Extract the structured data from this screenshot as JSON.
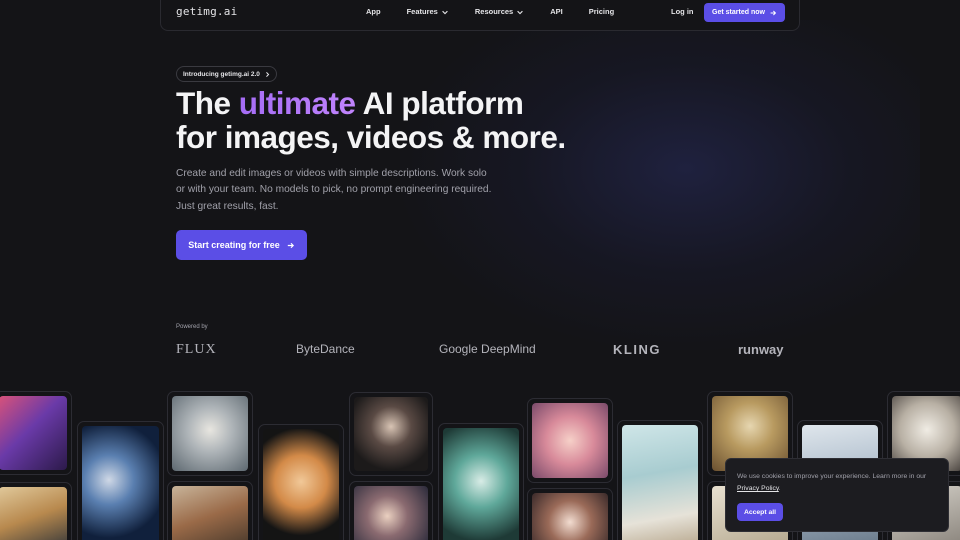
{
  "header": {
    "logo": "getimg.ai",
    "nav": [
      {
        "label": "App"
      },
      {
        "label": "Features"
      },
      {
        "label": "Resources"
      },
      {
        "label": "API"
      },
      {
        "label": "Pricing"
      }
    ],
    "login_label": "Log in",
    "get_started_label": "Get started now"
  },
  "hero": {
    "pill": "Introducing getimg.ai 2.0",
    "headline_1": "The ",
    "headline_highlight": "ultimate",
    "headline_2": " AI platform",
    "headline_3": "for images, videos & more.",
    "subtitle_1": "Create and edit images or videos with simple descriptions. Work solo",
    "subtitle_2": "or with your team. No models to pick, no prompt engineering required.",
    "subtitle_3": "Just great results, fast.",
    "cta_label": "Start creating for free"
  },
  "powered": {
    "label": "Powered by",
    "partners": [
      "FLUX",
      "ByteDance",
      "Google DeepMind",
      "KLING",
      "runway"
    ]
  },
  "cookie": {
    "text": "We use cookies to improve your experience. Learn more in our ",
    "link": "Privacy Policy",
    "after": ".",
    "accept_label": "Accept all"
  },
  "colors": {
    "accent": "#5b4ee6",
    "highlight": "#b37af7",
    "background": "#141417"
  }
}
